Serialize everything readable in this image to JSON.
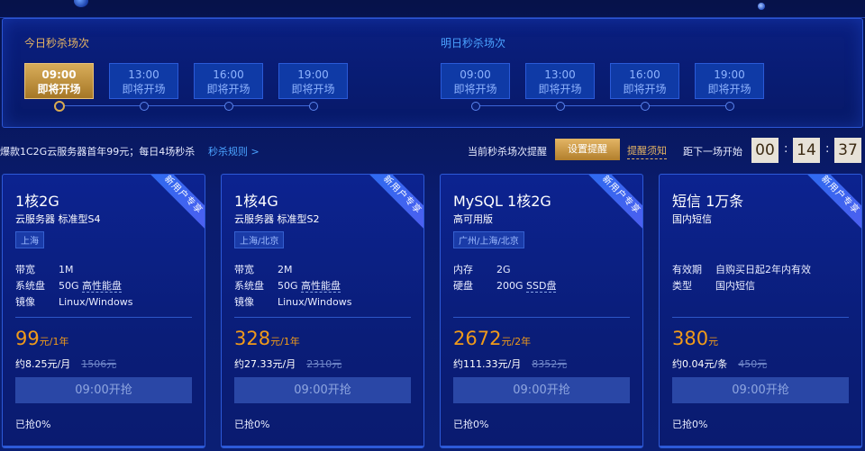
{
  "schedule": {
    "today_title": "今日秒杀场次",
    "tomorrow_title": "明日秒杀场次",
    "today": [
      {
        "time": "09:00",
        "status": "即将开场",
        "active": true
      },
      {
        "time": "13:00",
        "status": "即将开场"
      },
      {
        "time": "16:00",
        "status": "即将开场"
      },
      {
        "time": "19:00",
        "status": "即将开场"
      }
    ],
    "tomorrow": [
      {
        "time": "09:00",
        "status": "即将开场"
      },
      {
        "time": "13:00",
        "status": "即将开场"
      },
      {
        "time": "16:00",
        "status": "即将开场"
      },
      {
        "time": "19:00",
        "status": "即将开场"
      }
    ]
  },
  "infobar": {
    "promo": "爆款1C2G云服务器首年99元；每日4场秒杀",
    "rules": "秒杀规则 >",
    "remind_label": "当前秒杀场次提醒",
    "remind_button": "设置提醒",
    "notice": "提醒须知",
    "countdown_label": "距下一场开始",
    "countdown": {
      "h": "00",
      "m": "14",
      "s": "37"
    }
  },
  "cards": [
    {
      "ribbon": "新用户专享",
      "name": "1核2G",
      "sub": "云服务器 标准型S4",
      "region": "上海",
      "specs": [
        {
          "k": "带宽",
          "v": "1M"
        },
        {
          "k": "系统盘",
          "v": "50G",
          "hl": "高性能盘"
        },
        {
          "k": "镜像",
          "v": "Linux/Windows"
        }
      ],
      "price": "99",
      "unit": "元/1年",
      "monthly": "约8.25元/月",
      "orig": "1506元",
      "buy": "09:00开抢",
      "grabbed": "已抢0%"
    },
    {
      "ribbon": "新用户专享",
      "name": "1核4G",
      "sub": "云服务器 标准型S2",
      "region": "上海/北京",
      "specs": [
        {
          "k": "带宽",
          "v": "2M"
        },
        {
          "k": "系统盘",
          "v": "50G",
          "hl": "高性能盘"
        },
        {
          "k": "镜像",
          "v": "Linux/Windows"
        }
      ],
      "price": "328",
      "unit": "元/1年",
      "monthly": "约27.33元/月",
      "orig": "2310元",
      "buy": "09:00开抢",
      "grabbed": "已抢0%"
    },
    {
      "ribbon": "新用户专享",
      "name": "MySQL 1核2G",
      "sub": "高可用版",
      "region": "广州/上海/北京",
      "specs": [
        {
          "k": "内存",
          "v": "2G"
        },
        {
          "k": "硬盘",
          "v": "200G",
          "hl": "SSD盘"
        }
      ],
      "price": "2672",
      "unit": "元/2年",
      "monthly": "约111.33元/月",
      "orig": "8352元",
      "buy": "09:00开抢",
      "grabbed": "已抢0%"
    },
    {
      "ribbon": "新用户专享",
      "name": "短信 1万条",
      "sub": "国内短信",
      "specs": [
        {
          "k": "有效期",
          "v": "自购买日起2年内有效"
        },
        {
          "k": "类型",
          "v": "国内短信"
        }
      ],
      "price": "380",
      "unit": "元",
      "monthly": "约0.04元/条",
      "orig": "450元",
      "buy": "09:00开抢",
      "grabbed": "已抢0%"
    }
  ]
}
